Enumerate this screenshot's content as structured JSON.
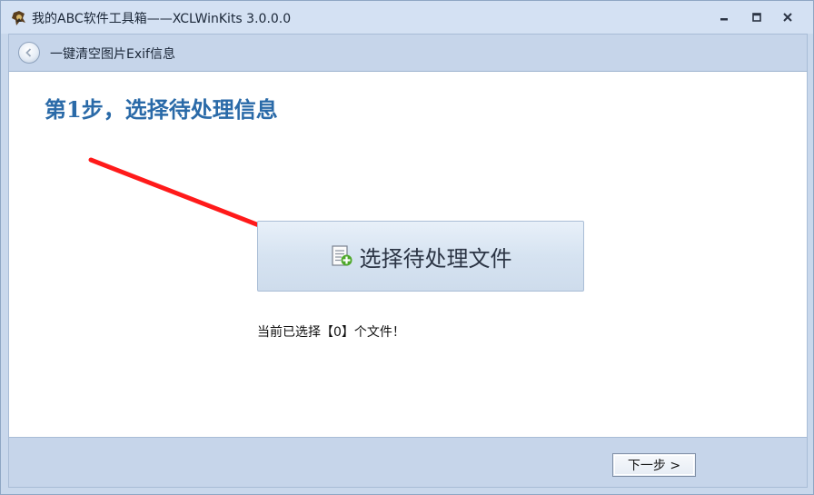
{
  "window": {
    "title": "我的ABC软件工具箱——XCLWinKits  3.0.0.0",
    "controls": {
      "minimize": "minimize",
      "maximize": "maximize",
      "close": "close"
    }
  },
  "toolbar": {
    "back_icon": "back-arrow-icon",
    "label": "一键清空图片Exif信息"
  },
  "main": {
    "step_title": "第1步，选择待处理信息",
    "select_button_label": "选择待处理文件",
    "select_button_icon": "file-add-icon",
    "status_text": "当前已选择【0】个文件！"
  },
  "footer": {
    "next_label": "下一步 >"
  },
  "colors": {
    "title_accent": "#2a6aa8",
    "arrow": "#ff0000",
    "chrome": "#c6d5ea"
  }
}
